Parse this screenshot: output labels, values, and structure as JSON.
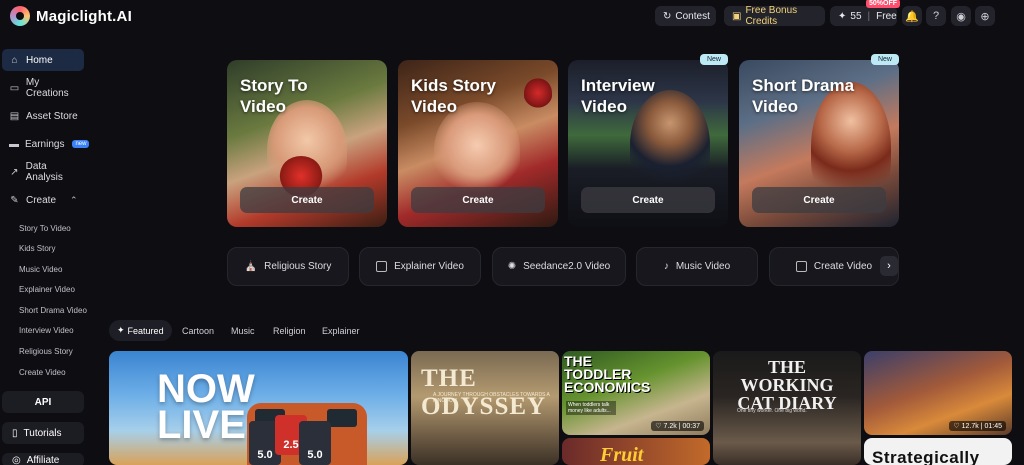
{
  "app": {
    "name": "Magiclight.AI"
  },
  "topbar": {
    "contest": "Contest",
    "bonus": "Free Bonus Credits",
    "credits": "55",
    "plan": "Free",
    "discount_badge": "50%OFF"
  },
  "sidebar": {
    "items": [
      {
        "label": "Home"
      },
      {
        "label": "My Creations"
      },
      {
        "label": "Asset Store"
      },
      {
        "label": "Earnings",
        "badge": "new"
      },
      {
        "label": "Data Analysis"
      },
      {
        "label": "Create"
      }
    ],
    "create_sub": [
      "Story To Video",
      "Kids Story",
      "Music Video",
      "Explainer Video",
      "Short Drama Video",
      "Interview Video",
      "Religious Story",
      "Create Video"
    ],
    "api": "API",
    "tutorials": "Tutorials",
    "affiliate": "Affiliate"
  },
  "hero_cards": [
    {
      "title_line1": "Story To",
      "title_line2": "Video",
      "button": "Create"
    },
    {
      "title_line1": "Kids Story",
      "title_line2": "Video",
      "button": "Create"
    },
    {
      "title_line1": "Interview",
      "title_line2": "Video",
      "button": "Create",
      "badge": "New"
    },
    {
      "title_line1": "Short Drama",
      "title_line2": "Video",
      "button": "Create",
      "badge": "New"
    }
  ],
  "categories": [
    "Religious Story",
    "Explainer Video",
    "Seedance2.0 Video",
    "Music Video",
    "Create Video"
  ],
  "tabs": [
    "Featured",
    "Cartoon",
    "Music",
    "Religion",
    "Explainer"
  ],
  "gallery": {
    "c1_title_line1": "NOW",
    "c1_title_line2": "LIVE",
    "c1_badge_left": "5.0",
    "c1_badge_right": "5.0",
    "c1_badge_top": "2.5",
    "c2_title": "THE ODYSSEY",
    "c2_sub": "A JOURNEY THROUGH OBSTACLES TOWARDS A KINGDOM",
    "c3_title_line1": "THE",
    "c3_title_line2": "TODDLER",
    "c3_title_line3": "ECONOMICS",
    "c3_caption": "When toddlers talk money like adults...",
    "c3_likes": "7.2k",
    "c3_duration": "00:37",
    "c3b_title": "Fruit",
    "c4_title_line1": "THE",
    "c4_title_line2": "WORKING",
    "c4_title_line3": "CAT DIARY",
    "c4_tag": "One tiny worker. One big world.",
    "c5_likes": "12.7k",
    "c5_duration": "01:45",
    "c5b_title": "Strategically"
  }
}
